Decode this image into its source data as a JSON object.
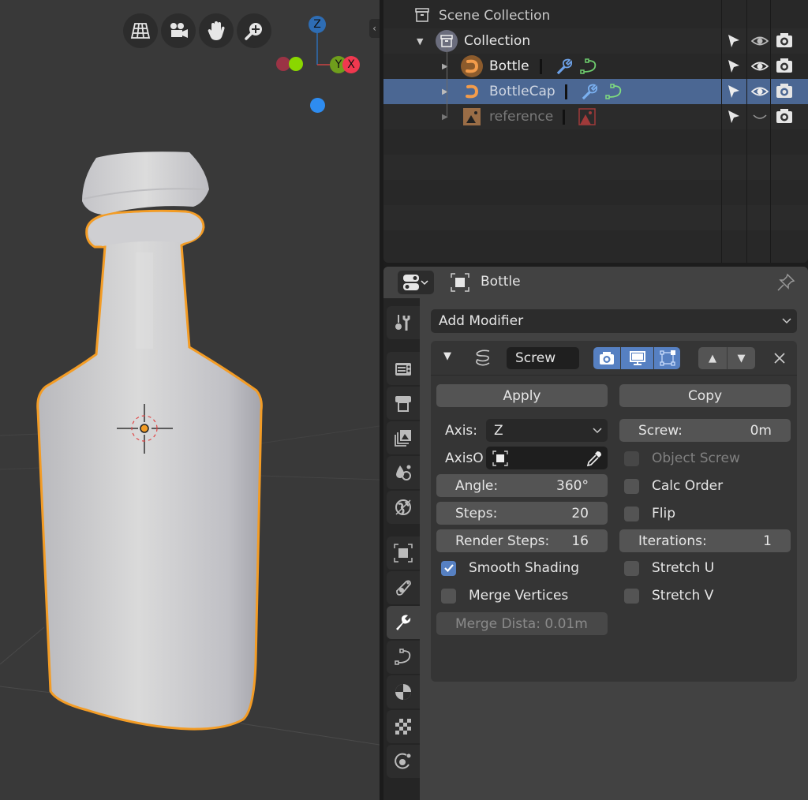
{
  "viewport": {
    "nav_buttons": [
      {
        "icon": "grid-icon"
      },
      {
        "icon": "camera-view-icon"
      },
      {
        "icon": "hand-pan-icon"
      },
      {
        "icon": "zoom-icon"
      }
    ],
    "gizmo": {
      "z_label": "Z",
      "y_label": "Y",
      "x_label": "X"
    },
    "colors": {
      "selection_outline": "#f39c25",
      "mesh": "#c8c8cc",
      "x_axis": "#f0384f",
      "y_axis": "#6f9e1c",
      "z_axis": "#2e6db4"
    }
  },
  "outliner": {
    "rows": [
      {
        "label": "Scene Collection",
        "icon": "scene-collection-icon"
      },
      {
        "label": "Collection",
        "icon": "collection-icon"
      },
      {
        "label": "Bottle",
        "icon": "mesh-object-icon",
        "modifiers": true,
        "curve": true
      },
      {
        "label": "BottleCap",
        "icon": "mesh-object-icon",
        "modifiers": true,
        "curve": true,
        "selected": true
      },
      {
        "label": "reference",
        "icon": "image-empty-icon",
        "image_data": true,
        "hidden": true
      }
    ]
  },
  "properties": {
    "object_name": "Bottle",
    "add_modifier_label": "Add Modifier",
    "modifier": {
      "name": "Screw",
      "apply_label": "Apply",
      "copy_label": "Copy",
      "axis_label": "Axis:",
      "axis_value": "Z",
      "axis_object_label": "AxisO",
      "screw_label": "Screw:",
      "screw_value": "0m",
      "object_screw_label": "Object Screw",
      "angle_label": "Angle:",
      "angle_value": "360°",
      "calc_order_label": "Calc Order",
      "steps_label": "Steps:",
      "steps_value": "20",
      "flip_label": "Flip",
      "render_steps_label": "Render Steps:",
      "render_steps_value": "16",
      "iterations_label": "Iterations:",
      "iterations_value": "1",
      "smooth_shading_label": "Smooth Shading",
      "smooth_shading": true,
      "stretch_u_label": "Stretch U",
      "stretch_u": false,
      "merge_vertices_label": "Merge Vertices",
      "merge_vertices": false,
      "stretch_v_label": "Stretch V",
      "stretch_v": false,
      "merge_distance_label": "Merge Dista: 0.01m",
      "object_screw": false,
      "calc_order": false,
      "flip": false
    },
    "tabs": [
      "tool-icon",
      "render-icon",
      "output-icon",
      "view-layer-icon",
      "scene-icon",
      "world-icon",
      "object-icon",
      "physics-icon",
      "modifier-icon",
      "data-curve-icon",
      "material-icon",
      "texture-icon",
      "constraint-icon"
    ],
    "active_tab": "modifier-icon",
    "accent_color": "#5680c2"
  }
}
